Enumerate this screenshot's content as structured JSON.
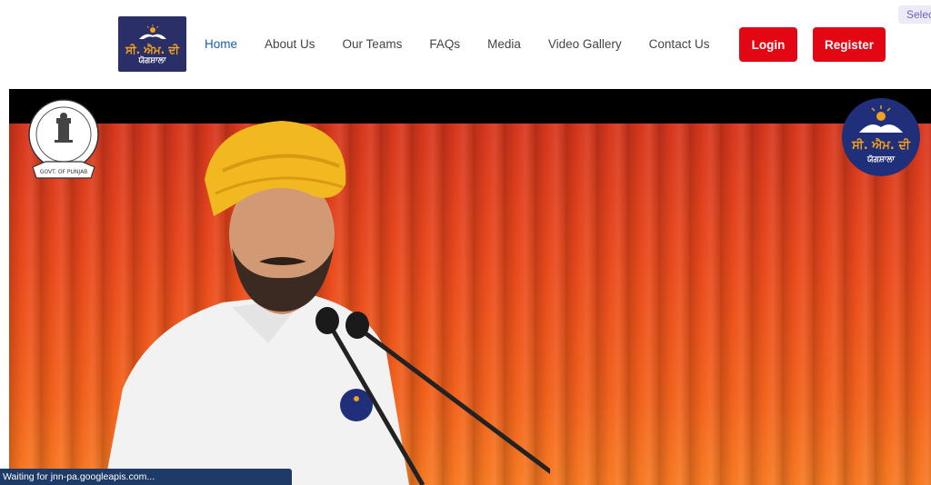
{
  "brand": {
    "logo_line1": "ਸੀ. ਐਮ. ਦੀ",
    "logo_line2": "ਯੋਗਸ਼ਾਲਾ",
    "logo_bg": "#2a2f67",
    "logo_accent": "#f4a11b"
  },
  "nav": {
    "items": [
      {
        "label": "Home",
        "active": true
      },
      {
        "label": "About Us"
      },
      {
        "label": "Our Teams"
      },
      {
        "label": "FAQs"
      },
      {
        "label": "Media"
      },
      {
        "label": "Video Gallery"
      },
      {
        "label": "Contact Us"
      }
    ],
    "active_color": "#1a5ea8"
  },
  "auth": {
    "login_label": "Login",
    "register_label": "Register",
    "button_color": "#e30613"
  },
  "language_select": {
    "text": "Select Language"
  },
  "hero": {
    "left_seal_text": "GOVT. OF PUNJAB",
    "right_logo_line1": "ਸੀ. ਐਮ. ਦੀ",
    "right_logo_line2": "ਯੋਗਸ਼ਾਲਾ"
  },
  "browser_status": {
    "text": "Waiting for jnn-pa.googleapis.com..."
  }
}
